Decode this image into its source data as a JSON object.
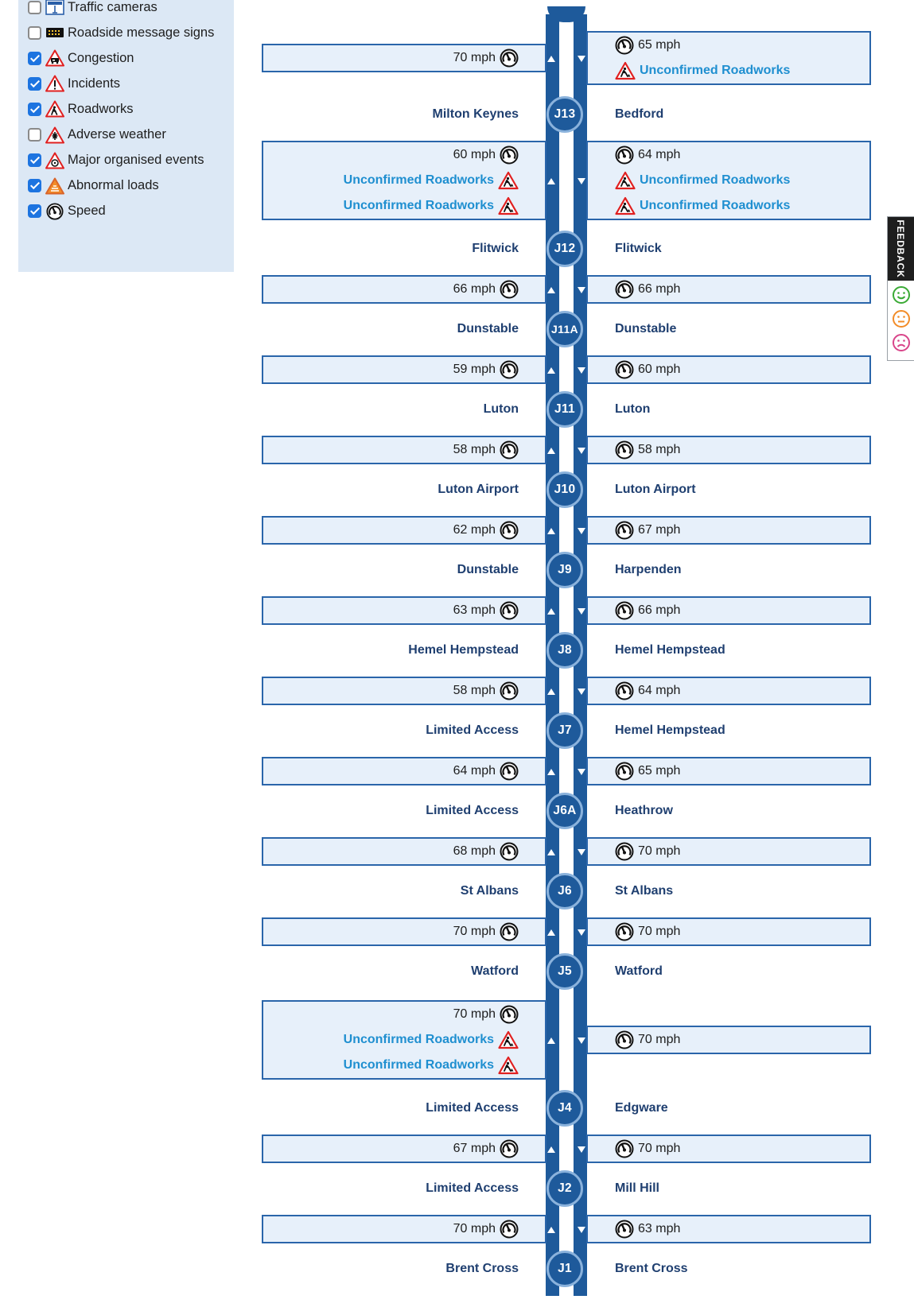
{
  "filters": [
    {
      "label": "Traffic cameras",
      "checked": false,
      "icon": "traffic-camera-icon"
    },
    {
      "label": "Roadside message signs",
      "checked": false,
      "icon": "message-sign-icon"
    },
    {
      "label": "Congestion",
      "checked": true,
      "icon": "congestion-icon"
    },
    {
      "label": "Incidents",
      "checked": true,
      "icon": "incident-icon"
    },
    {
      "label": "Roadworks",
      "checked": true,
      "icon": "roadworks-icon"
    },
    {
      "label": "Adverse weather",
      "checked": false,
      "icon": "adverse-weather-icon"
    },
    {
      "label": "Major organised events",
      "checked": true,
      "icon": "major-event-icon"
    },
    {
      "label": "Abnormal loads",
      "checked": true,
      "icon": "abnormal-load-icon"
    },
    {
      "label": "Speed",
      "checked": true,
      "icon": "speed-icon"
    }
  ],
  "junctions": [
    {
      "id": "J13",
      "left": "Milton Keynes",
      "right": "Bedford"
    },
    {
      "id": "J12",
      "left": "Flitwick",
      "right": "Flitwick"
    },
    {
      "id": "J11A",
      "left": "Dunstable",
      "right": "Dunstable"
    },
    {
      "id": "J11",
      "left": "Luton",
      "right": "Luton"
    },
    {
      "id": "J10",
      "left": "Luton Airport",
      "right": "Luton Airport"
    },
    {
      "id": "J9",
      "left": "Dunstable",
      "right": "Harpenden"
    },
    {
      "id": "J8",
      "left": "Hemel Hempstead",
      "right": "Hemel Hempstead"
    },
    {
      "id": "J7",
      "left": "Limited Access",
      "right": "Hemel Hempstead"
    },
    {
      "id": "J6A",
      "left": "Limited Access",
      "right": "Heathrow"
    },
    {
      "id": "J6",
      "left": "St Albans",
      "right": "St Albans"
    },
    {
      "id": "J5",
      "left": "Watford",
      "right": "Watford"
    },
    {
      "id": "J4",
      "left": "Limited Access",
      "right": "Edgware"
    },
    {
      "id": "J2",
      "left": "Limited Access",
      "right": "Mill Hill"
    },
    {
      "id": "J1",
      "left": "Brent Cross",
      "right": "Brent Cross"
    }
  ],
  "segments": [
    {
      "left": {
        "speed": "70 mph",
        "events": []
      },
      "right": {
        "speed": "65 mph",
        "events": [
          "Unconfirmed Roadworks"
        ]
      }
    },
    {
      "left": {
        "speed": "60 mph",
        "events": [
          "Unconfirmed Roadworks",
          "Unconfirmed Roadworks"
        ]
      },
      "right": {
        "speed": "64 mph",
        "events": [
          "Unconfirmed Roadworks",
          "Unconfirmed Roadworks"
        ]
      }
    },
    {
      "left": {
        "speed": "66 mph",
        "events": []
      },
      "right": {
        "speed": "66 mph",
        "events": []
      }
    },
    {
      "left": {
        "speed": "59 mph",
        "events": []
      },
      "right": {
        "speed": "60 mph",
        "events": []
      }
    },
    {
      "left": {
        "speed": "58 mph",
        "events": []
      },
      "right": {
        "speed": "58 mph",
        "events": []
      }
    },
    {
      "left": {
        "speed": "62 mph",
        "events": []
      },
      "right": {
        "speed": "67 mph",
        "events": []
      }
    },
    {
      "left": {
        "speed": "63 mph",
        "events": []
      },
      "right": {
        "speed": "66 mph",
        "events": []
      }
    },
    {
      "left": {
        "speed": "58 mph",
        "events": []
      },
      "right": {
        "speed": "64 mph",
        "events": []
      }
    },
    {
      "left": {
        "speed": "64 mph",
        "events": []
      },
      "right": {
        "speed": "65 mph",
        "events": []
      }
    },
    {
      "left": {
        "speed": "68 mph",
        "events": []
      },
      "right": {
        "speed": "70 mph",
        "events": []
      }
    },
    {
      "left": {
        "speed": "70 mph",
        "events": []
      },
      "right": {
        "speed": "70 mph",
        "events": []
      }
    },
    {
      "left": {
        "speed": "70 mph",
        "events": [
          "Unconfirmed Roadworks",
          "Unconfirmed Roadworks"
        ]
      },
      "right": {
        "speed": "70 mph",
        "events": []
      }
    },
    {
      "left": {
        "speed": "67 mph",
        "events": []
      },
      "right": {
        "speed": "70 mph",
        "events": []
      }
    },
    {
      "left": {
        "speed": "70 mph",
        "events": []
      },
      "right": {
        "speed": "63 mph",
        "events": []
      }
    }
  ],
  "feedback": {
    "label": "FEEDBACK"
  },
  "colors": {
    "road": "#1e5a9b",
    "destination_text": "#1f3f70",
    "event_link": "#1f8fd0",
    "panel_bg": "#dce8f5",
    "checkbox_on": "#1d74e0"
  }
}
